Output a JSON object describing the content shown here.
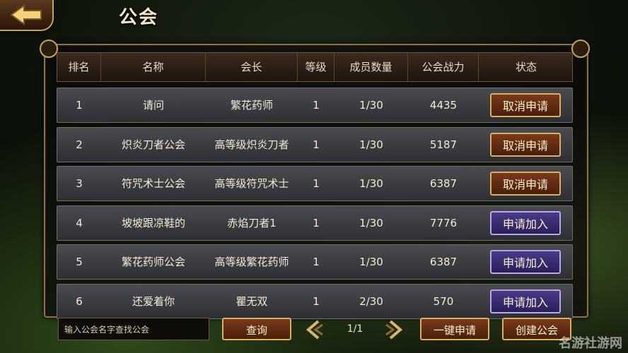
{
  "title": "公会",
  "headers": [
    "排名",
    "名称",
    "会长",
    "等级",
    "成员数量",
    "公会战力",
    "状态"
  ],
  "rows": [
    {
      "rank": "1",
      "name": "请问",
      "leader": "繁花药师",
      "level": "1",
      "members": "1/30",
      "power": "4435",
      "status": "取消申请",
      "status_type": "cancel"
    },
    {
      "rank": "2",
      "name": "炽炎刀者公会",
      "leader": "高等级炽炎刀者",
      "level": "1",
      "members": "1/30",
      "power": "5187",
      "status": "取消申请",
      "status_type": "cancel"
    },
    {
      "rank": "3",
      "name": "符咒术士公会",
      "leader": "高等级符咒术士",
      "level": "1",
      "members": "1/30",
      "power": "6387",
      "status": "取消申请",
      "status_type": "cancel"
    },
    {
      "rank": "4",
      "name": "坡坡跟凉鞋的",
      "leader": "赤焰刀者1",
      "level": "1",
      "members": "1/30",
      "power": "7776",
      "status": "申请加入",
      "status_type": "join"
    },
    {
      "rank": "5",
      "name": "繁花药师公会",
      "leader": "高等级繁花药师",
      "level": "1",
      "members": "1/30",
      "power": "6387",
      "status": "申请加入",
      "status_type": "join"
    },
    {
      "rank": "6",
      "name": "还爱着你",
      "leader": "瞿无双",
      "level": "1",
      "members": "2/30",
      "power": "570",
      "status": "申请加入",
      "status_type": "join"
    }
  ],
  "bottom": {
    "search_placeholder": "输入公会名字查找公会",
    "search_button": "查询",
    "page": "1/1",
    "one_click_apply": "一键申请",
    "create": "创建公会"
  },
  "watermark": "名游社游网",
  "icons": {
    "back": "back-arrow-icon",
    "prev": "chevron-left-icon",
    "next": "chevron-right-icon"
  }
}
